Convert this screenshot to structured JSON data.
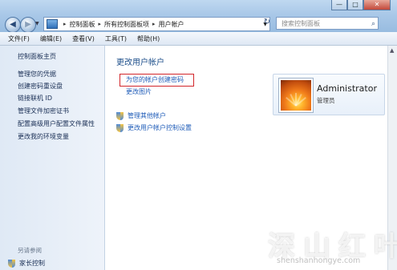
{
  "window": {
    "minimize_glyph": "—",
    "maximize_glyph": "□",
    "close_glyph": "✕"
  },
  "nav": {
    "back_glyph": "◀",
    "forward_glyph": "▶",
    "dropdown_glyph": "▼",
    "refresh_glyph": "↻"
  },
  "address": {
    "segments": [
      "控制面板",
      "所有控制面板项",
      "用户帐户"
    ],
    "separator": "▸"
  },
  "search": {
    "placeholder": "搜索控制面板",
    "icon": "search-icon"
  },
  "menubar": {
    "items": [
      "文件(F)",
      "编辑(E)",
      "查看(V)",
      "工具(T)",
      "帮助(H)"
    ]
  },
  "sidebar": {
    "home": "控制面板主页",
    "links": [
      "管理您的凭据",
      "创建密码重设盘",
      "链接联机 ID",
      "管理文件加密证书",
      "配置高级用户配置文件属性",
      "更改我的环境变量"
    ],
    "see_also": "另请参阅",
    "parental": "家长控制"
  },
  "main": {
    "title": "更改用户帐户",
    "create_password": "为您的帐户创建密码",
    "change_picture": "更改图片",
    "manage_other": "管理其他帐户",
    "uac_settings": "更改用户帐户控制设置"
  },
  "account": {
    "name": "Administrator",
    "role": "管理员"
  },
  "highlight_color": "#d2262b",
  "watermark": {
    "text": "深山红叶",
    "url": "shenshanhongye.com"
  }
}
